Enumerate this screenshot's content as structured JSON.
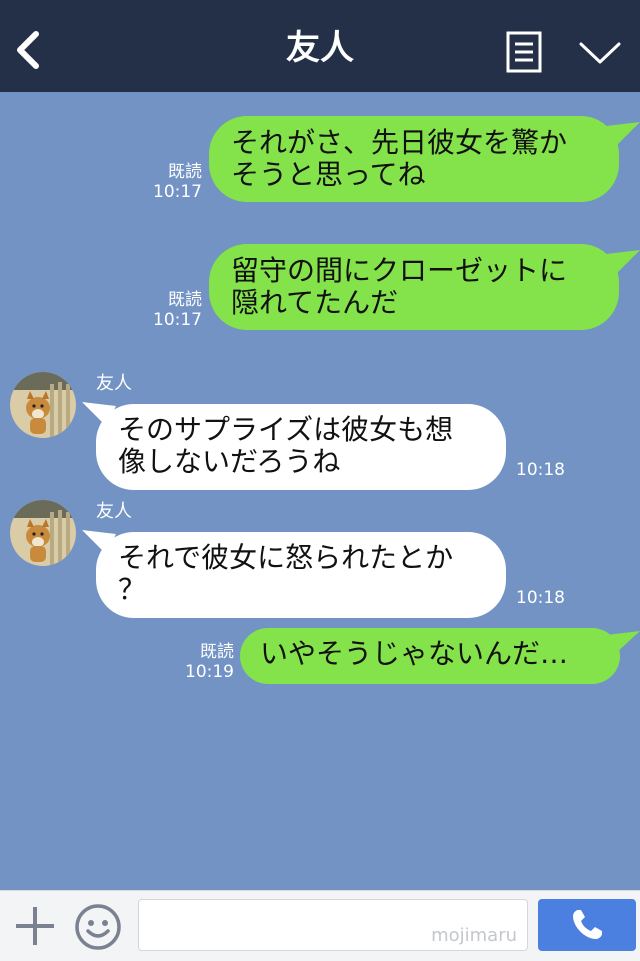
{
  "header": {
    "title": "友人",
    "icons": [
      "back-arrow-icon",
      "menu-list-icon",
      "chevron-down-icon"
    ],
    "background": "#243048"
  },
  "chat": {
    "background": "#7293c4",
    "messages": [
      {
        "side": "out",
        "text_lines": [
          "それがさ、先日彼女を驚か",
          "そうと思ってね"
        ],
        "read": "既読",
        "time": "10:17"
      },
      {
        "side": "out",
        "text_lines": [
          "留守の間にクローゼットに",
          "隠れてたんだ"
        ],
        "read": "既読",
        "time": "10:17"
      },
      {
        "side": "in",
        "sender": "友人",
        "text_lines": [
          "そのサプライズは彼女も想",
          "像しないだろうね"
        ],
        "time": "10:18"
      },
      {
        "side": "in",
        "sender": "友人",
        "text_lines": [
          "それで彼女に怒られたとか",
          "？"
        ],
        "time": "10:18"
      },
      {
        "side": "out",
        "text_lines": [
          "いやそうじゃないんだ…"
        ],
        "read": "既読",
        "time": "10:19"
      }
    ],
    "colors": {
      "outgoing_bubble": "#84e24a",
      "incoming_bubble": "#ffffff"
    }
  },
  "footer": {
    "input_value": "",
    "watermark": "mojimaru",
    "icons": [
      "plus-icon",
      "emoji-icon",
      "phone-icon"
    ],
    "call_button_color": "#4b7fe0"
  }
}
